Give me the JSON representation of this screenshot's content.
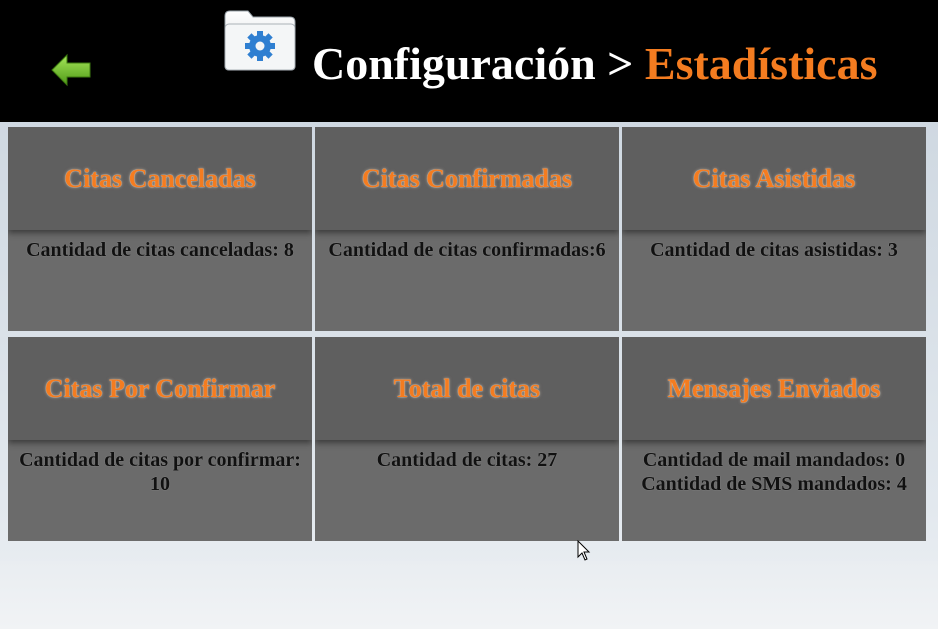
{
  "header": {
    "title_prefix": "Configuración >",
    "title_accent": "Estadísticas",
    "back_icon": "arrow-left-icon",
    "settings_icon": "folder-gear-icon"
  },
  "colors": {
    "accent": "#f47c20",
    "header_bg": "#000000",
    "card_bg": "#6b6b6b",
    "back_arrow": "#6cc424"
  },
  "cards": [
    {
      "title": "Citas Canceladas",
      "lines": [
        "Cantidad de citas canceladas: 8"
      ]
    },
    {
      "title": "Citas Confirmadas",
      "lines": [
        "Cantidad de citas confirmadas:6"
      ]
    },
    {
      "title": "Citas Asistidas",
      "lines": [
        "Cantidad de citas asistidas: 3"
      ]
    },
    {
      "title": "Citas Por Confirmar",
      "lines": [
        "Cantidad de citas por confirmar: 10"
      ]
    },
    {
      "title": "Total de citas",
      "lines": [
        "Cantidad de citas: 27"
      ]
    },
    {
      "title": "Mensajes Enviados",
      "lines": [
        "Cantidad de mail mandados: 0",
        "Cantidad de SMS mandados: 4"
      ]
    }
  ]
}
